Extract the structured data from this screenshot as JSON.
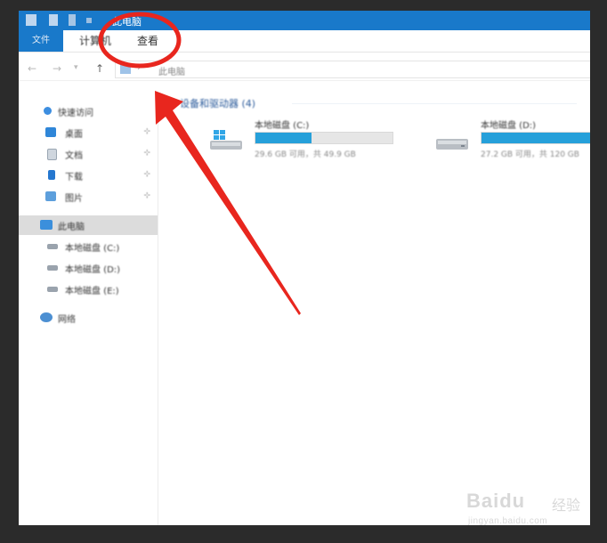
{
  "window": {
    "title": "此电脑",
    "quick_access_icons": [
      "save-icon",
      "folder-icon",
      "undo-icon",
      "dropdown-icon"
    ]
  },
  "ribbon": {
    "file_tab": "文件",
    "computer_tab": "计算机",
    "view_tab": "查看"
  },
  "address_bar": {
    "back": "←",
    "forward": "→",
    "recent": "▾",
    "up": "↑",
    "path_icon": "monitor-icon",
    "separator": "›",
    "path_text": "此电脑"
  },
  "sidebar": {
    "items": [
      {
        "label": "快速访问",
        "icon": "star-icon",
        "pinned": false,
        "selected": false
      },
      {
        "label": "桌面",
        "icon": "desktop-folder-icon",
        "pinned": true,
        "selected": false
      },
      {
        "label": "文档",
        "icon": "documents-folder-icon",
        "pinned": true,
        "selected": false
      },
      {
        "label": "下载",
        "icon": "downloads-folder-icon",
        "pinned": true,
        "selected": false
      },
      {
        "label": "图片",
        "icon": "pictures-folder-icon",
        "pinned": true,
        "selected": false
      },
      {
        "label": "此电脑",
        "icon": "computer-icon",
        "pinned": false,
        "selected": true
      },
      {
        "label": "本地磁盘 (C:)",
        "icon": "drive-icon",
        "pinned": false,
        "selected": false
      },
      {
        "label": "本地磁盘 (D:)",
        "icon": "drive-icon",
        "pinned": false,
        "selected": false
      },
      {
        "label": "本地磁盘 (E:)",
        "icon": "drive-icon",
        "pinned": false,
        "selected": false
      },
      {
        "label": "网络",
        "icon": "network-icon",
        "pinned": false,
        "selected": false
      }
    ],
    "pin_glyph": "⊹"
  },
  "content": {
    "section_title": "设备和驱动器 (4)",
    "drives": [
      {
        "name": "本地磁盘 (C:)",
        "free_text": "29.6 GB 可用，共 49.9 GB",
        "used_fraction": 0.41,
        "icon": "windows-drive-icon"
      },
      {
        "name": "本地磁盘 (D:)",
        "free_text": "27.2 GB 可用，共 120 GB",
        "used_fraction": 0.8,
        "icon": "drive-icon"
      }
    ]
  },
  "colors": {
    "titlebar": "#1979ca",
    "progress": "#26a0da",
    "annotation": "#e8261e"
  },
  "watermark": {
    "logo": "Baidu",
    "sub": "经验",
    "url": "jingyan.baidu.com"
  }
}
